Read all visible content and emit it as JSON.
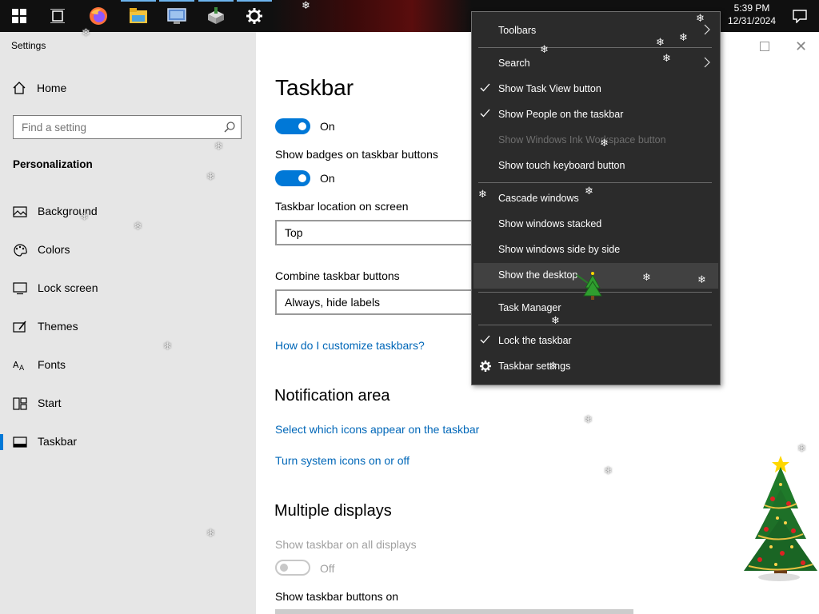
{
  "taskbar": {
    "apps": [
      {
        "icon": "windows-start-icon"
      },
      {
        "icon": "task-view-icon"
      },
      {
        "icon": "firefox-icon"
      },
      {
        "icon": "file-explorer-icon"
      },
      {
        "icon": "control-panel-icon"
      },
      {
        "icon": "installer-icon"
      },
      {
        "icon": "settings-gear-icon"
      }
    ],
    "time": "5:39 PM",
    "date": "12/31/2024"
  },
  "window": {
    "title": "Settings"
  },
  "sidebar": {
    "home": "Home",
    "search_placeholder": "Find a setting",
    "section": "Personalization",
    "items": [
      {
        "label": "Background",
        "icon": "picture-icon"
      },
      {
        "label": "Colors",
        "icon": "palette-icon"
      },
      {
        "label": "Lock screen",
        "icon": "lock-screen-icon"
      },
      {
        "label": "Themes",
        "icon": "brush-icon"
      },
      {
        "label": "Fonts",
        "icon": "font-icon"
      },
      {
        "label": "Start",
        "icon": "start-icon"
      },
      {
        "label": "Taskbar",
        "icon": "taskbar-icon",
        "active": true
      }
    ]
  },
  "main": {
    "title": "Taskbar",
    "toggle1_state": "On",
    "badges_label": "Show badges on taskbar buttons",
    "toggle2_state": "On",
    "location_label": "Taskbar location on screen",
    "location_value": "Top",
    "combine_label": "Combine taskbar buttons",
    "combine_value": "Always, hide labels",
    "customize_link": "How do I customize taskbars?",
    "notification_heading": "Notification area",
    "notif_link1": "Select which icons appear on the taskbar",
    "notif_link2": "Turn system icons on or off",
    "multi_heading": "Multiple displays",
    "multi_all_label": "Show taskbar on all displays",
    "multi_all_state": "Off",
    "multi_buttons_label": "Show taskbar buttons on"
  },
  "context_menu": {
    "items": {
      "toolbars": "Toolbars",
      "search": "Search",
      "task_view": "Show Task View button",
      "people": "Show People on the taskbar",
      "ink": "Show Windows Ink Workspace button",
      "touch_kb": "Show touch keyboard button",
      "cascade": "Cascade windows",
      "stacked": "Show windows stacked",
      "side_by_side": "Show windows side by side",
      "desktop": "Show the desktop",
      "task_manager": "Task Manager",
      "lock": "Lock the taskbar",
      "settings": "Taskbar settings"
    }
  },
  "colors": {
    "accent": "#0078d7",
    "link": "#0067b8",
    "menu_bg": "#2b2b2b",
    "taskbar_bg": "#101010",
    "sidebar_bg": "#e6e6e6"
  }
}
